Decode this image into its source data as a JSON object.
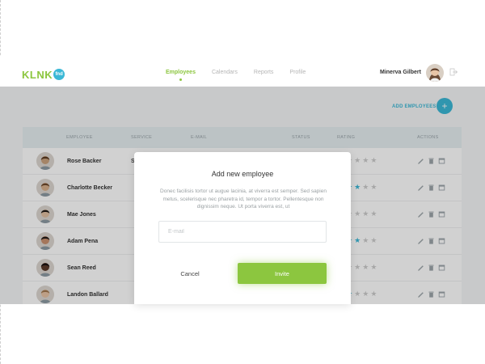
{
  "header": {
    "logo_text": "KLNK",
    "logo_badge": "fnd",
    "nav": [
      {
        "label": "Employees",
        "active": true
      },
      {
        "label": "Calendars",
        "active": false
      },
      {
        "label": "Reports",
        "active": false
      },
      {
        "label": "Profile",
        "active": false
      }
    ],
    "user_name": "Minerva Gilbert"
  },
  "toolbar": {
    "add_label": "ADD EMPLOYEES",
    "add_icon": "+"
  },
  "table": {
    "columns": [
      "EMPLOYEE",
      "SERVICE",
      "E-MAIL",
      "STATUS",
      "RATING",
      "ACTIONS"
    ],
    "rows": [
      {
        "name": "Rose Backer",
        "service": "Se",
        "rating": 0,
        "skin": "#c9a27e",
        "hair": "#5a3a22"
      },
      {
        "name": "Charlotte Becker",
        "service": "",
        "rating": 3,
        "skin": "#d8b08c",
        "hair": "#6e4a2d"
      },
      {
        "name": "Mae Jones",
        "service": "",
        "rating": 0,
        "skin": "#e0bfa2",
        "hair": "#1f1a17"
      },
      {
        "name": "Adam Pena",
        "service": "",
        "rating": 3,
        "skin": "#c89070",
        "hair": "#201a18"
      },
      {
        "name": "Sean Reed",
        "service": "",
        "rating": 0,
        "skin": "#5b3a2a",
        "hair": "#1a1210"
      },
      {
        "name": "Landon Ballard",
        "service": "",
        "rating": 2,
        "skin": "#e7c3a4",
        "hair": "#a07850"
      }
    ]
  },
  "modal": {
    "title": "Add new employee",
    "text": "Donec facilisis tortor ut augue lacinia, at viverra est semper. Sed sapien metus, scelerisque nec pharetra id, tempor a tortor. Pellentesque non dignissim neque. Ut porta viverra est, ut",
    "email_placeholder": "E-mail",
    "email_value": "",
    "cancel_label": "Cancel",
    "invite_label": "Invite"
  },
  "colors": {
    "brand_green": "#8cc63f",
    "brand_blue": "#3bb8d6"
  }
}
